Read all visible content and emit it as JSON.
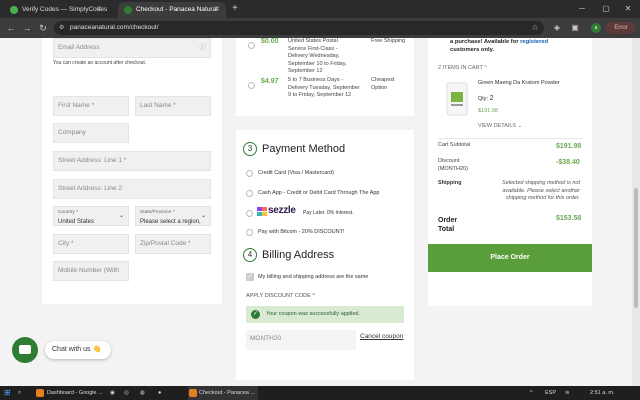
{
  "browser": {
    "tabs": [
      {
        "title": "Verify Codes — SimplyCodes"
      },
      {
        "title": "Checkout - Panacea Natural"
      }
    ],
    "url": "panaceanatural.com/checkout/",
    "error_label": "Error",
    "profile_initial": "a"
  },
  "billing_form": {
    "email_placeholder": "Email Address",
    "account_note": "You can create an account after checkout.",
    "first_name": "First Name *",
    "last_name": "Last Name *",
    "company": "Company",
    "street1": "Street Address: Line 1 *",
    "street2": "Street Address: Line 2",
    "country_label": "Country *",
    "country_value": "United States",
    "state_label": "State/Province *",
    "state_value": "Please select a region, state",
    "city": "City *",
    "zip": "Zip/Postal Code *",
    "mobile": "Mobile Number (With"
  },
  "shipping": {
    "options": [
      {
        "price": "$0.00",
        "desc": "United States Postal Service First-Class - Delivery Wednesday, September 10 to Friday, September 12",
        "label": "Free Shipping"
      },
      {
        "price": "$4.97",
        "desc": "5 to 7 Business Days - Delivery Tuesday, September 9 to Friday, September 12",
        "label": "Cheapest Option"
      }
    ]
  },
  "payment": {
    "step": "3",
    "heading": "Payment Method",
    "opt_card": "Credit Card (Visa / Mastercard)",
    "opt_cashapp": "Cash App - Credit or Debit Card Through The App",
    "sezzle_brand": "sezzle",
    "sezzle_note": "Pay Later. 0% Interest.",
    "opt_bitcoin": "Pay with Bitcoin - 20% DISCOUNT!"
  },
  "billing_address": {
    "step": "4",
    "heading": "Billing Address",
    "same_as_shipping": "My billing and shipping address are the same"
  },
  "discount": {
    "toggle_label": "APPLY DISCOUNT CODE",
    "success_message": "Your coupon was successfully applied.",
    "code_value": "MONTH20",
    "cancel_label": "Cancel coupon"
  },
  "summary": {
    "purchase_note_1": "a purchase! Available for",
    "purchase_note_link": "registered",
    "purchase_note_2": "customers only.",
    "items_in_cart": "2 ITEMS IN CART",
    "item_name": "Green Maeng Da Kratom Powder",
    "qty_label": "Qty:",
    "qty_value": "2",
    "item_price": "$191.98",
    "view_details": "VIEW DETAILS",
    "cart_subtotal_label": "Cart Subtotal",
    "cart_subtotal_value": "$191.98",
    "discount_label": "Discount",
    "discount_code": "(MONTH20)",
    "discount_value": "-$38.40",
    "shipping_label": "Shipping",
    "shipping_note": "Selected shipping method is not available. Please select another shipping method for this order.",
    "order_total_label_1": "Order",
    "order_total_label_2": "Total",
    "order_total_value": "$153.58",
    "place_order": "Place Order"
  },
  "chat": {
    "label": "Chat with us",
    "emoji": "👋"
  },
  "taskbar": {
    "item1": "Dashboard - Google ...",
    "item2": "Checkout - Panacea ...",
    "lang": "ESP",
    "time": "2:51 a. m."
  },
  "colors": {
    "brand_green": "#2e7d32",
    "price_green": "#6aa84f",
    "place_order_bg": "#5a9e3a"
  }
}
